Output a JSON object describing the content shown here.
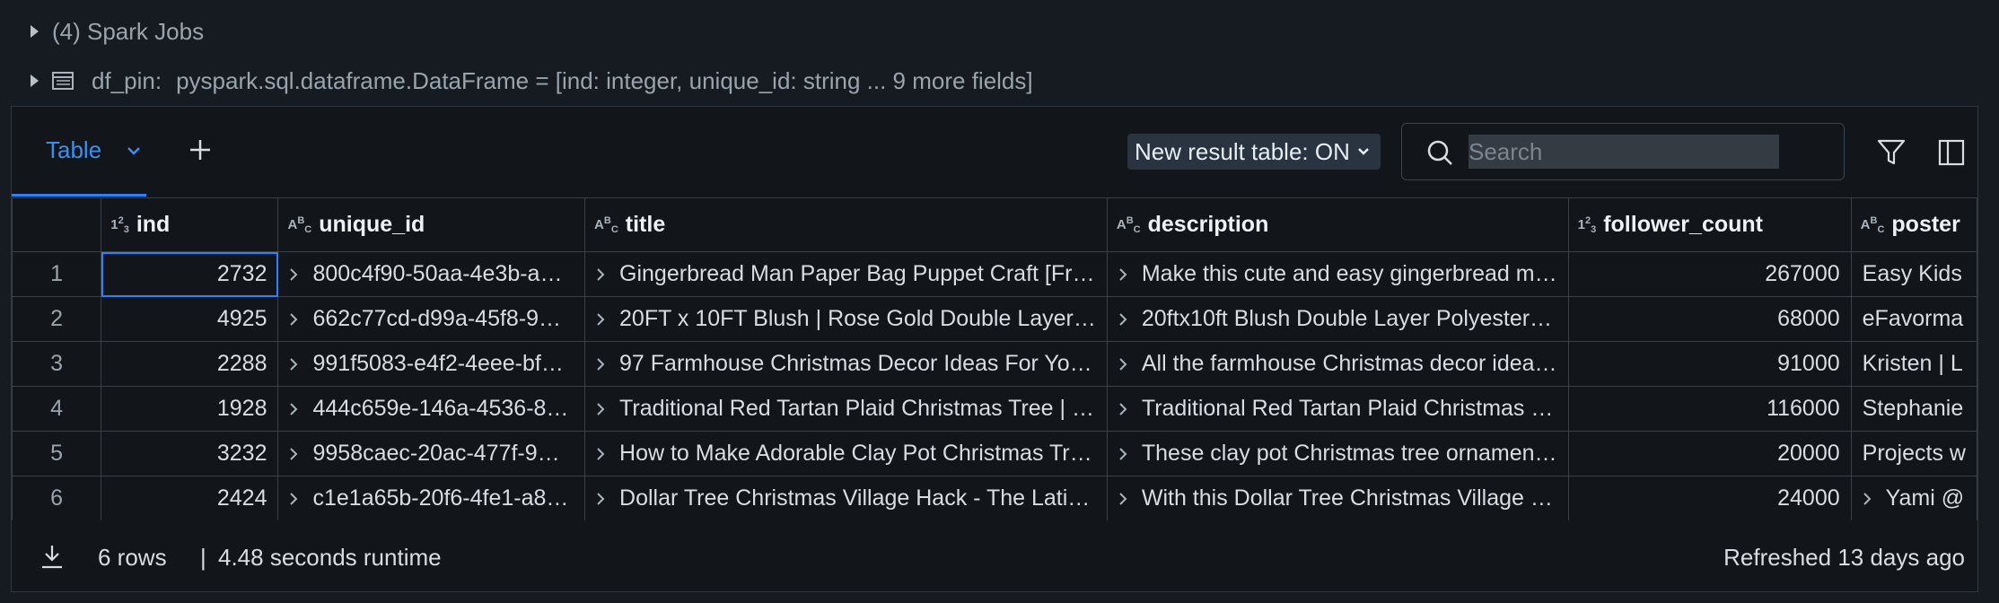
{
  "jobs": {
    "label": "(4) Spark Jobs"
  },
  "df": {
    "name": "df_pin:",
    "schema": "pyspark.sql.dataframe.DataFrame = [ind: integer, unique_id: string ... 9 more fields]"
  },
  "toolbar": {
    "tab_label": "Table",
    "new_result_label": "New result table: ON",
    "search_placeholder": "Search"
  },
  "columns": [
    {
      "name": "ind",
      "type": "123"
    },
    {
      "name": "unique_id",
      "type": "ABC"
    },
    {
      "name": "title",
      "type": "ABC"
    },
    {
      "name": "description",
      "type": "ABC"
    },
    {
      "name": "follower_count",
      "type": "123"
    },
    {
      "name": "poster",
      "type": "ABC"
    }
  ],
  "rows": [
    {
      "idx": "1",
      "ind": "2732",
      "unique_id": "800c4f90-50aa-4e3b-a…",
      "title": "Gingerbread Man Paper Bag Puppet Craft [Fr…",
      "description": "Make this cute and easy gingerbread m…",
      "follower_count": "267000",
      "poster": "Easy Kids"
    },
    {
      "idx": "2",
      "ind": "4925",
      "unique_id": "662c77cd-d99a-45f8-9…",
      "title": "20FT x 10FT Blush | Rose Gold Double Layer…",
      "description": "20ftx10ft Blush Double Layer Polyester…",
      "follower_count": "68000",
      "poster": "eFavorma"
    },
    {
      "idx": "3",
      "ind": "2288",
      "unique_id": "991f5083-e4f2-4eee-bf…",
      "title": "97 Farmhouse Christmas Decor Ideas For Yo…",
      "description": "All the farmhouse Christmas decor idea…",
      "follower_count": "91000",
      "poster": "Kristen | L"
    },
    {
      "idx": "4",
      "ind": "1928",
      "unique_id": "444c659e-146a-4536-8…",
      "title": "Traditional Red Tartan Plaid Christmas Tree | …",
      "description": "Traditional Red Tartan Plaid Christmas …",
      "follower_count": "116000",
      "poster": "Stephanie"
    },
    {
      "idx": "5",
      "ind": "3232",
      "unique_id": "9958caec-20ac-477f-9…",
      "title": "How to Make Adorable Clay Pot Christmas Tr…",
      "description": "These clay pot Christmas tree ornamen…",
      "follower_count": "20000",
      "poster": "Projects w"
    },
    {
      "idx": "6",
      "ind": "2424",
      "unique_id": "c1e1a65b-20f6-4fe1-a8…",
      "title": "Dollar Tree Christmas Village Hack - The Lati…",
      "description": "With this Dollar Tree Christmas Village …",
      "follower_count": "24000",
      "poster": "Yami @"
    }
  ],
  "footer": {
    "rows_label": "6 rows",
    "separator": "|",
    "runtime_label": "4.48 seconds runtime",
    "refreshed_label": "Refreshed 13 days ago"
  }
}
